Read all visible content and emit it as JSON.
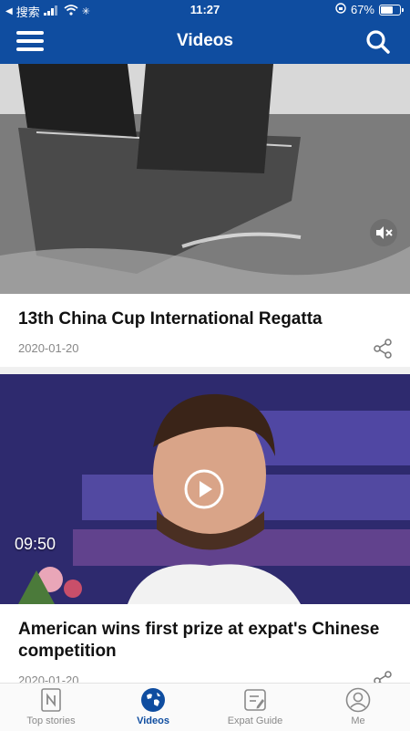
{
  "status_bar": {
    "carrier": "搜索",
    "time": "11:27",
    "battery": "67%",
    "battery_level": 0.67
  },
  "header": {
    "title": "Videos"
  },
  "feed": [
    {
      "title": "13th China Cup International Regatta",
      "date": "2020-01-20"
    },
    {
      "title": "American wins first prize at expat's Chinese competition",
      "date": "2020-01-20",
      "duration": "09:50"
    }
  ],
  "tabs": [
    {
      "label": "Top stories",
      "icon": "newspaper-icon"
    },
    {
      "label": "Videos",
      "icon": "globe-icon"
    },
    {
      "label": "Expat Guide",
      "icon": "guide-icon"
    },
    {
      "label": "Me",
      "icon": "user-icon"
    }
  ],
  "colors": {
    "brand": "#0f4da0",
    "tab_inactive": "#8a8a8a"
  }
}
